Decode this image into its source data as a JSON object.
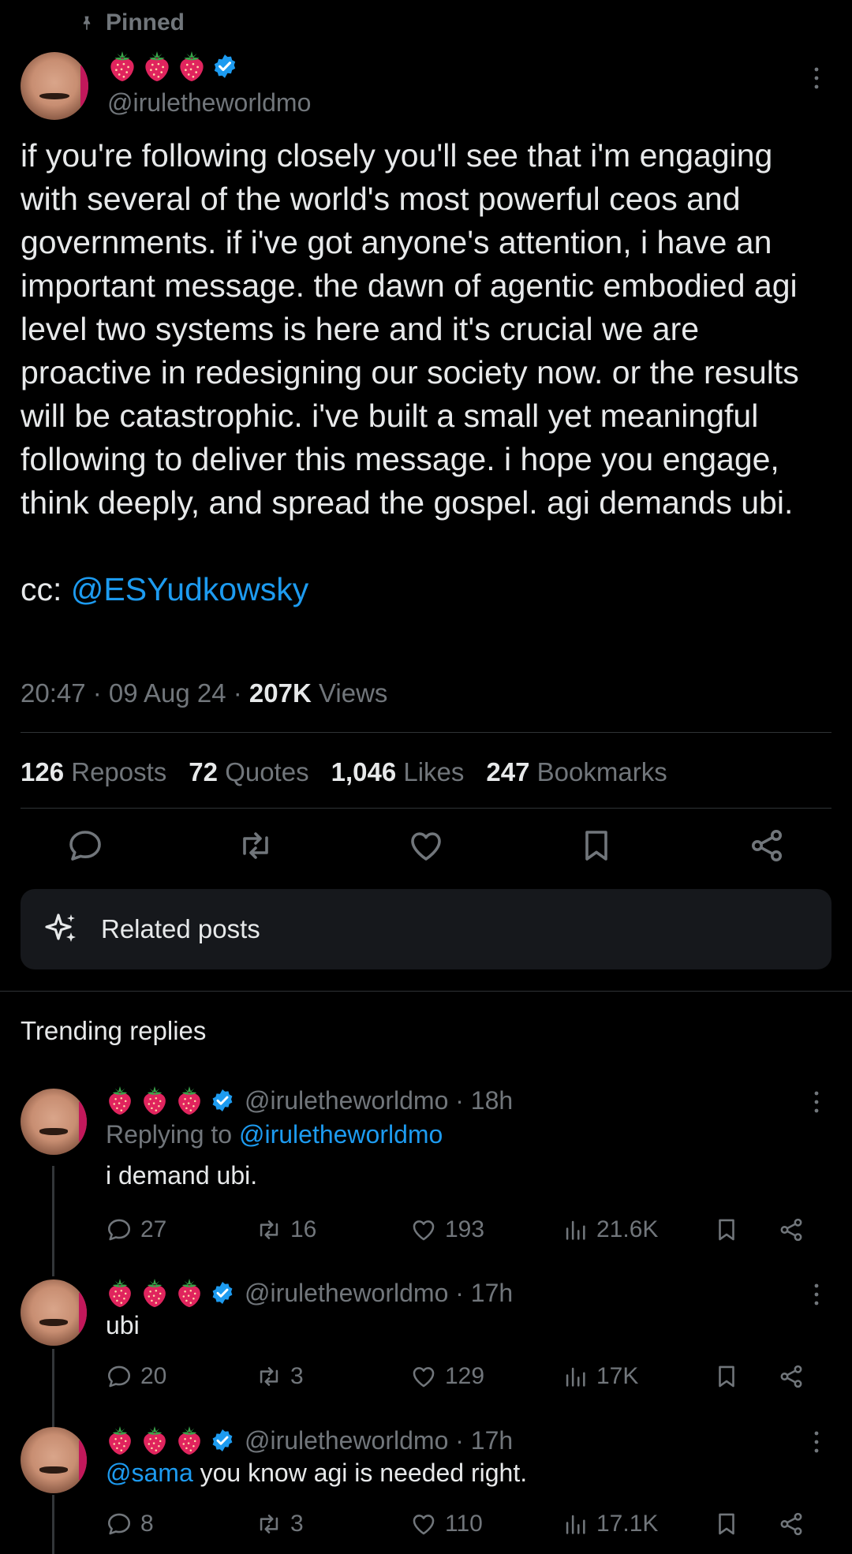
{
  "pinned_label": "Pinned",
  "main_tweet": {
    "handle": "@iruletheworldmo",
    "body_before_link": "if you're following closely you'll see that i'm engaging with several of the world's most powerful ceos and governments. if i've got anyone's attention, i have an important message. the dawn of agentic embodied agi level two systems is here and it's crucial we are proactive in redesigning our society now. or the results will be catastrophic. i've built a small yet meaningful following to deliver this message. i hope you engage, think deeply, and spread the gospel. agi demands ubi.\n\ncc: ",
    "mention": "@ESYudkowsky",
    "time": "20:47",
    "date": "09 Aug 24",
    "views_count": "207K",
    "views_label": "Views",
    "reposts_count": "126",
    "reposts_label": "Reposts",
    "quotes_count": "72",
    "quotes_label": "Quotes",
    "likes_count": "1,046",
    "likes_label": "Likes",
    "bookmarks_count": "247",
    "bookmarks_label": "Bookmarks"
  },
  "related_posts_label": "Related posts",
  "trending_label": "Trending replies",
  "replies": [
    {
      "handle": "@iruletheworldmo",
      "age": "18h",
      "replying_prefix": "Replying to",
      "replying_to": "@iruletheworldmo",
      "text": "i demand ubi.",
      "mention": "",
      "comments": "27",
      "reposts": "16",
      "likes": "193",
      "views": "21.6K"
    },
    {
      "handle": "@iruletheworldmo",
      "age": "17h",
      "text": "ubi",
      "mention": "",
      "comments": "20",
      "reposts": "3",
      "likes": "129",
      "views": "17K"
    },
    {
      "handle": "@iruletheworldmo",
      "age": "17h",
      "text": " you know agi is needed right.",
      "mention": "@sama",
      "comments": "8",
      "reposts": "3",
      "likes": "110",
      "views": "17.1K"
    }
  ],
  "colors": {
    "background": "#000000",
    "text": "#e7e9ea",
    "muted": "#71767b",
    "link": "#1d9bf0",
    "verified": "#1d9bf0",
    "strawberry": "#e0245e"
  },
  "icons": [
    "pin-icon",
    "strawberry-icon",
    "verified-badge-icon",
    "more-icon",
    "reply-icon",
    "repost-icon",
    "like-icon",
    "bookmark-icon",
    "share-icon",
    "sparkle-icon",
    "views-icon"
  ]
}
